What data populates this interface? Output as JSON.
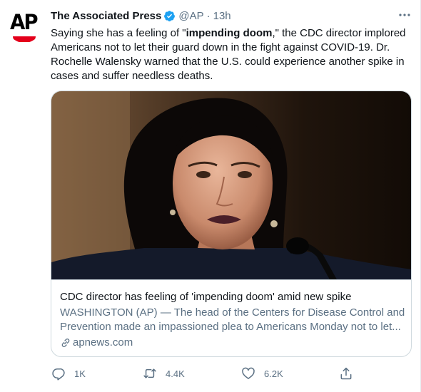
{
  "tweet": {
    "author_name": "The Associated Press",
    "handle": "@AP",
    "separator": "·",
    "time": "13h",
    "avatar_text": "AP",
    "text_before": "Saying she has a feeling of \"",
    "text_bold": "impending doom",
    "text_after": ",\" the CDC director implored Americans not to let their guard down in the fight against COVID-19. Dr. Rochelle Walensky warned that the U.S. could experience another spike in cases and suffer needless deaths."
  },
  "card": {
    "title": "CDC director has feeling of 'impending doom' amid new spike",
    "description_line1": "WASHINGTON (AP) — The head of the Centers for Disease Control and",
    "description_line2": "Prevention made an impassioned plea to Americans Monday not to let...",
    "domain": "apnews.com"
  },
  "actions": {
    "reply_count": "1K",
    "retweet_count": "4.4K",
    "like_count": "6.2K"
  },
  "colors": {
    "verified": "#1da1f2",
    "secondary_text": "#5b7083",
    "border": "#cfd9de",
    "brand_red": "#e4001b"
  },
  "icons": {
    "verified": "verified-badge-icon",
    "more": "more-horizontal-icon",
    "link": "link-icon",
    "reply": "reply-icon",
    "retweet": "retweet-icon",
    "like": "heart-icon",
    "share": "share-icon"
  }
}
